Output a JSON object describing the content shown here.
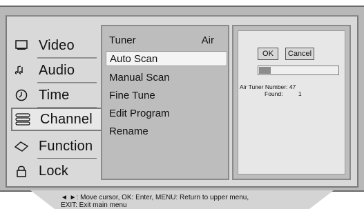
{
  "left_menu": {
    "items": [
      {
        "label": "Video",
        "icon": "screen-icon"
      },
      {
        "label": "Audio",
        "icon": "music-note-icon"
      },
      {
        "label": "Time",
        "icon": "clock-icon"
      },
      {
        "label": "Channel",
        "icon": "channel-list-icon",
        "selected": true
      },
      {
        "label": "Function",
        "icon": "diamond-icon"
      },
      {
        "label": "Lock",
        "icon": "padlock-icon"
      }
    ]
  },
  "submenu": {
    "tuner_label": "Tuner",
    "tuner_value": "Air",
    "items": [
      "Auto Scan",
      "Manual Scan",
      "Fine Tune",
      "Edit Program",
      "Rename"
    ],
    "active_item": "Auto Scan"
  },
  "scan_panel": {
    "ok_label": "OK",
    "cancel_label": "Cancel",
    "progress": 0.15,
    "tuner_number_label": "Air Tuner Number:",
    "tuner_number_value": "47",
    "found_label": "Found:",
    "found_value": "1"
  },
  "hint": {
    "line1": "◄ ►: Move cursor,   OK: Enter, MENU: Return to upper menu,",
    "line2": "EXIT: Exit main menu"
  }
}
